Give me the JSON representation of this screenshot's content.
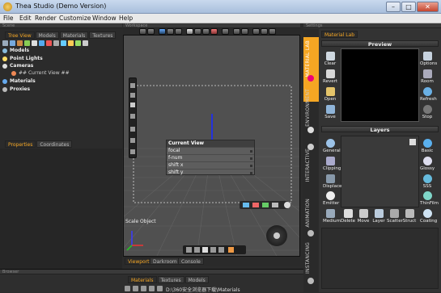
{
  "window": {
    "title": "Thea Studio (Demo Version)",
    "minimize": "–",
    "maximize": "□",
    "close": "✕"
  },
  "menu": [
    "File",
    "Edit",
    "Render",
    "Customize",
    "Window",
    "Help"
  ],
  "panels": {
    "scene": "Scene",
    "workspace": "Workspace",
    "settings": "Settings",
    "browser": "Browser"
  },
  "left_tabs": [
    "Tree View",
    "Models",
    "Materials",
    "Textures"
  ],
  "tree": {
    "models": "Models",
    "point_lights": "Point Lights",
    "cameras": "Cameras",
    "current_view": "## Current View ##",
    "materials": "Materials",
    "proxies": "Proxies"
  },
  "prop_tabs": [
    "Properties",
    "Coordinates"
  ],
  "viewport": {
    "camera_panel": {
      "title": "Current View",
      "rows": [
        "focal",
        "f-num",
        "shift x",
        "shift y"
      ]
    },
    "scale_label": "Scale Object",
    "tabs": [
      "Viewport",
      "Darkroom",
      "Console"
    ]
  },
  "right": {
    "tab": "Material Lab",
    "rail_tabs": [
      "MATERIAL LAB",
      "ENVIRONMENT",
      "INTERACTIVE",
      "ANIMATION",
      "INSTANCING"
    ],
    "preview_title": "Preview",
    "preview_left": [
      "Clear",
      "Revert",
      "Open",
      "Save"
    ],
    "preview_right": [
      "Options",
      "Room",
      "Refresh",
      "Stop"
    ],
    "layers_title": "Layers",
    "layers_left": [
      "General",
      "Clipping",
      "Displace",
      "Emitter",
      "Medium"
    ],
    "layers_right": [
      "Basic",
      "Glossy",
      "SSS",
      "ThinFilm",
      "Coating"
    ],
    "layer_tools": [
      "Delete",
      "Move",
      "Layer",
      "Scatter",
      "Struct"
    ]
  },
  "browser": {
    "tabs": [
      "Materials",
      "Textures",
      "Models"
    ],
    "path": "D:\\360安全浏览器下载\\Materials"
  },
  "colors": {
    "accent": "#f5a623",
    "panel": "#2b2b2b",
    "viewport": "#505050",
    "titlebar": "#b8cbe6"
  }
}
